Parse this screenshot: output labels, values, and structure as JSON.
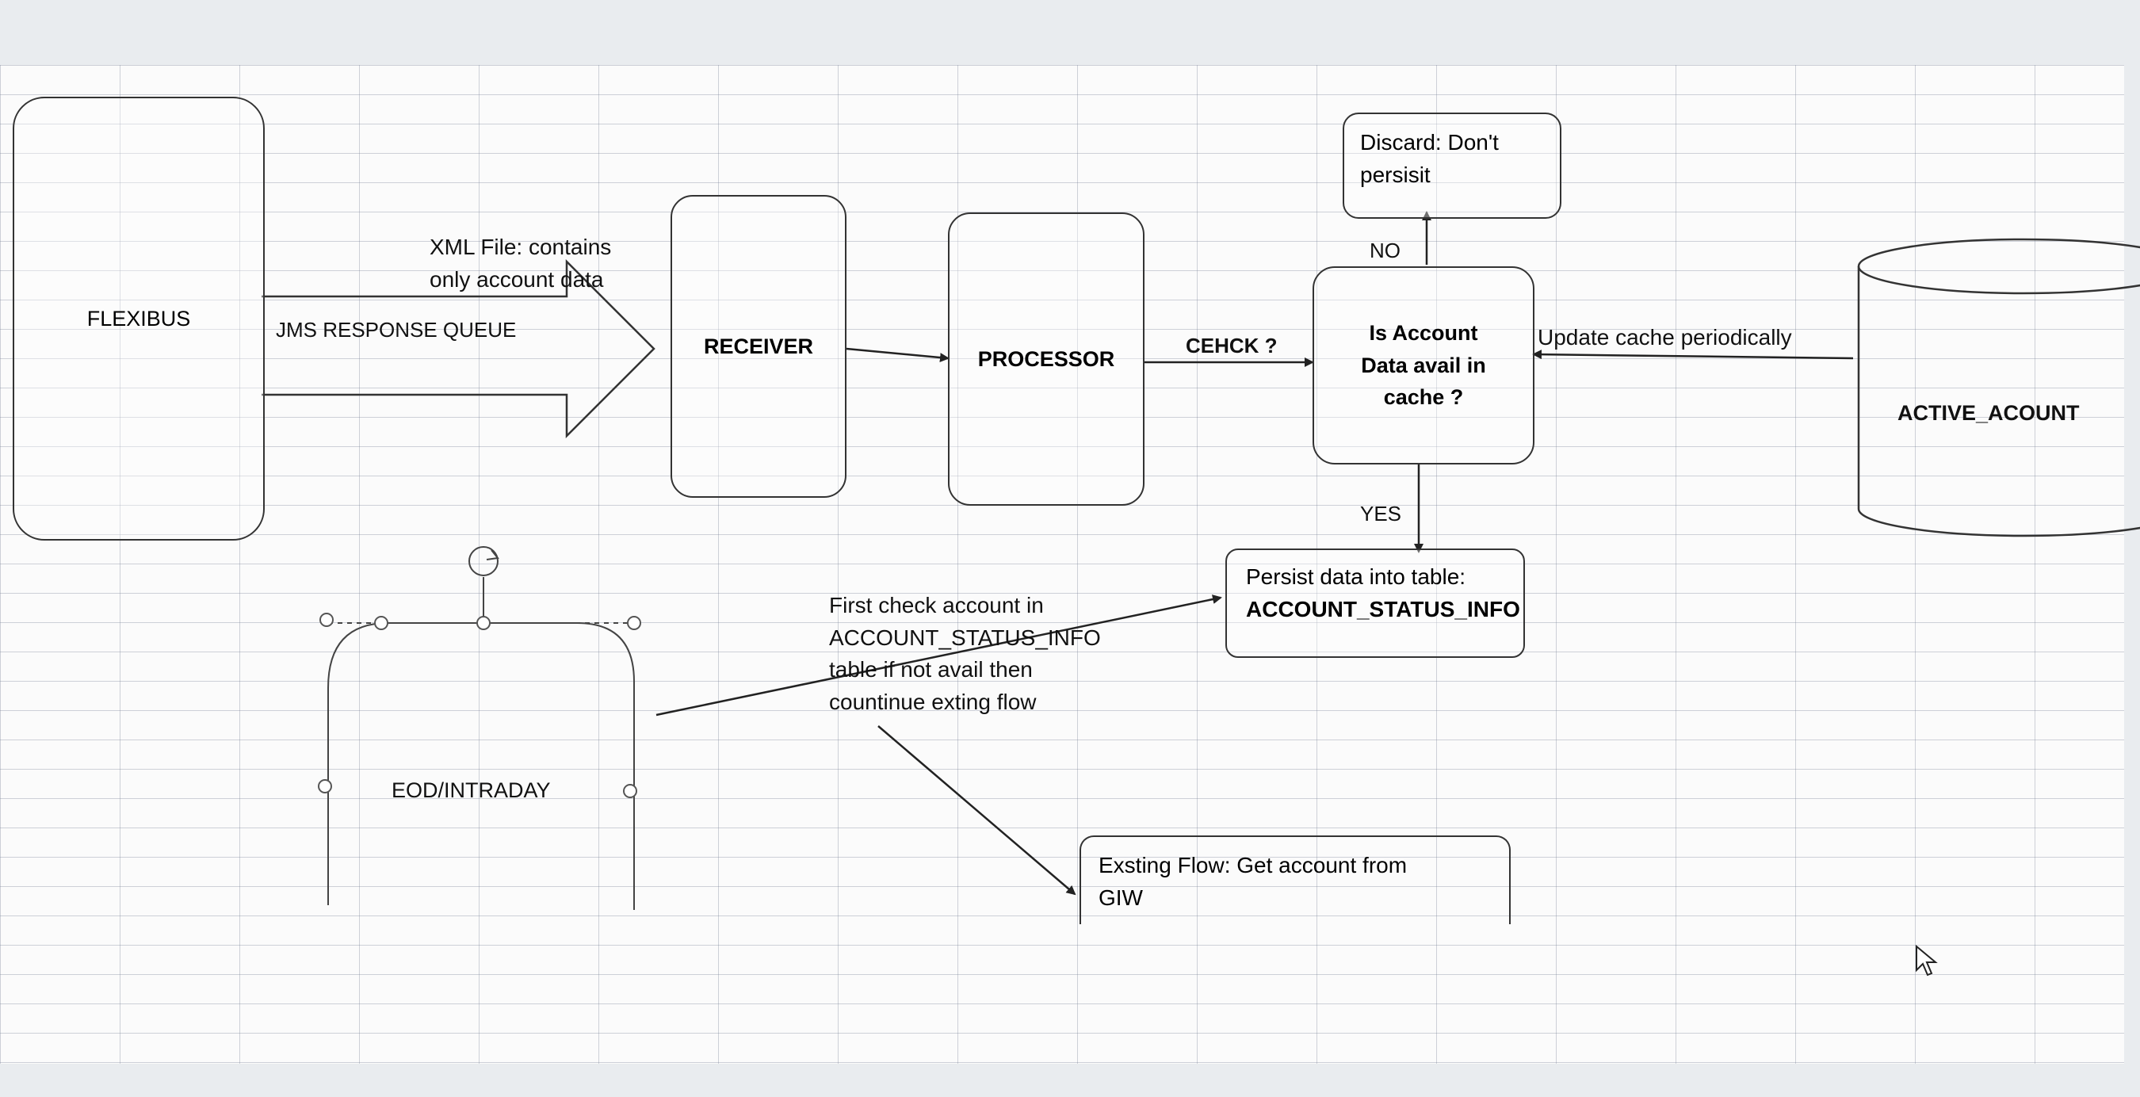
{
  "nodes": {
    "flexibus": "FLEXIBUS",
    "receiver": "RECEIVER",
    "processor": "PROCESSOR",
    "decision": [
      "Is Account",
      "Data avail in",
      "cache ?"
    ],
    "discard": [
      "Discard: Don't",
      "persisit"
    ],
    "active_account": "ACTIVE_ACOUNT",
    "persist": [
      "Persist data into table:",
      "ACCOUNT_STATUS_INFO"
    ],
    "eod": "EOD/INTRADAY",
    "existing_flow": [
      "Exsting Flow: Get account from",
      "GIW"
    ]
  },
  "labels": {
    "xml_file": [
      "XML File: contains",
      "only account data"
    ],
    "jms_queue": "JMS RESPONSE QUEUE",
    "check": "CEHCK ?",
    "no": "NO",
    "yes": "YES",
    "update_cache": "Update cache periodically",
    "first_check": [
      "First check account in",
      "ACCOUNT_STATUS_INFO",
      "table if not avail then",
      "countinue exting flow"
    ]
  },
  "colors": {
    "stroke": "#333333",
    "grid": "#8c96a8",
    "paper": "#fbfbfb"
  }
}
